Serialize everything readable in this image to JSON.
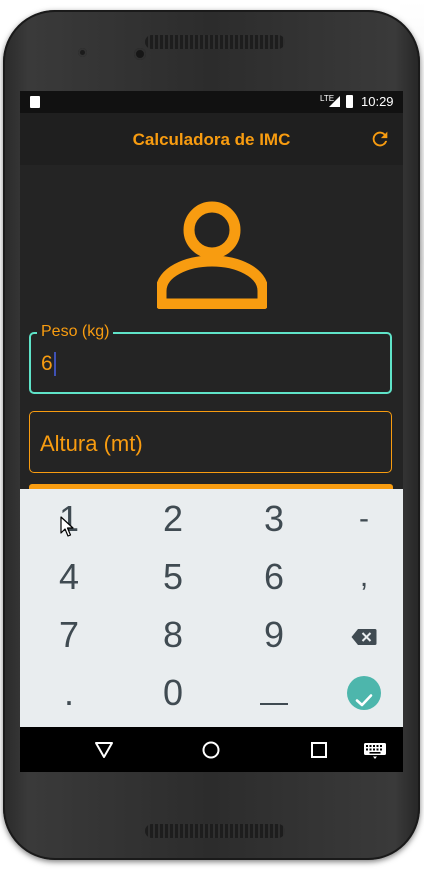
{
  "status_bar": {
    "network": "LTE",
    "time": "10:29"
  },
  "app_bar": {
    "title": "Calculadora de IMC",
    "refresh_icon": "refresh-icon"
  },
  "avatar_icon": "person-icon",
  "form": {
    "peso": {
      "label": "Peso (kg)",
      "value": "6"
    },
    "altura": {
      "placeholder": "Altura (mt)"
    }
  },
  "keypad": {
    "rows": [
      [
        "1",
        "2",
        "3",
        "-"
      ],
      [
        "4",
        "5",
        "6",
        ","
      ],
      [
        "7",
        "8",
        "9",
        "backspace-icon"
      ],
      [
        ".",
        "0",
        "space-icon",
        "check-icon"
      ]
    ]
  },
  "nav_bar": {
    "back_icon": "back-triangle-icon",
    "home_icon": "home-circle-icon",
    "recents_icon": "recents-square-icon",
    "keyboard_icon": "keyboard-icon"
  },
  "colors": {
    "accent": "#f89c10",
    "focus_border": "#5fe3c8",
    "background": "#242424",
    "confirm": "#4db6ac"
  }
}
